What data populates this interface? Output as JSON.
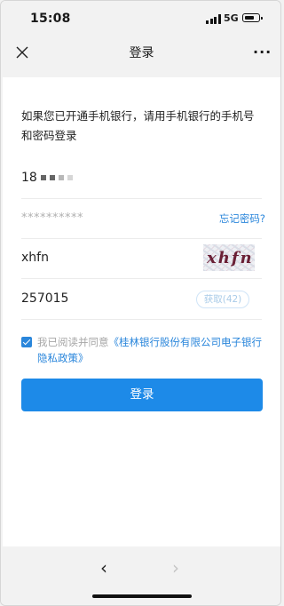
{
  "status_bar": {
    "time": "15:08",
    "network": "5G"
  },
  "nav": {
    "title": "登录",
    "more": "···"
  },
  "intro_text": "如果您已开通手机银行，请用手机银行的手机号和密码登录",
  "form": {
    "phone_prefix": "18",
    "password_mask": "**********",
    "forgot_password": "忘记密码?",
    "captcha_value": "xhfn",
    "captcha_image_text": "xhfn",
    "sms_code_value": "257015",
    "sms_button": "获取(42)"
  },
  "agreement": {
    "prefix": "我已阅读并同意",
    "link": "《桂林银行股份有限公司电子银行隐私政策》"
  },
  "login_button": "登录",
  "bottom_nav": {
    "back": "‹",
    "forward": "›"
  }
}
